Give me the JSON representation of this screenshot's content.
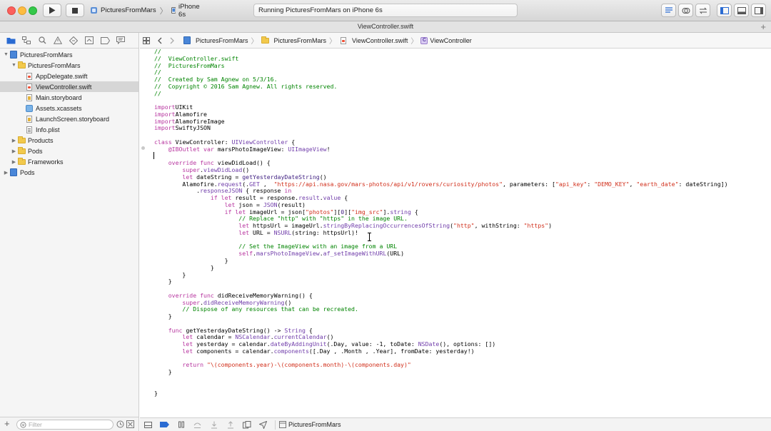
{
  "toolbar": {
    "scheme_target": "PicturesFromMars",
    "scheme_device": "iPhone 6s",
    "status_text": "Running PicturesFromMars on iPhone 6s"
  },
  "tab_title": "ViewController.swift",
  "navigator": {
    "items": [
      {
        "label": "PicturesFromMars",
        "type": "project",
        "depth": 0,
        "expanded": true
      },
      {
        "label": "PicturesFromMars",
        "type": "folder",
        "depth": 1,
        "expanded": true
      },
      {
        "label": "AppDelegate.swift",
        "type": "swift",
        "depth": 2
      },
      {
        "label": "ViewController.swift",
        "type": "swift",
        "depth": 2,
        "selected": true
      },
      {
        "label": "Main.storyboard",
        "type": "storyboard",
        "depth": 2
      },
      {
        "label": "Assets.xcassets",
        "type": "assets",
        "depth": 2
      },
      {
        "label": "LaunchScreen.storyboard",
        "type": "storyboard",
        "depth": 2
      },
      {
        "label": "Info.plist",
        "type": "plist",
        "depth": 2
      },
      {
        "label": "Products",
        "type": "folder",
        "depth": 1,
        "expanded": false
      },
      {
        "label": "Pods",
        "type": "folder",
        "depth": 1,
        "expanded": false
      },
      {
        "label": "Frameworks",
        "type": "folder",
        "depth": 1,
        "expanded": false
      },
      {
        "label": "Pods",
        "type": "project",
        "depth": 0,
        "expanded": false
      }
    ],
    "filter_placeholder": "Filter"
  },
  "jumpbar": {
    "crumbs": [
      "PicturesFromMars",
      "PicturesFromMars",
      "ViewController.swift",
      "ViewController"
    ]
  },
  "code_lines": [
    [
      [
        "cm",
        "//"
      ]
    ],
    [
      [
        "cm",
        "//  ViewController.swift"
      ]
    ],
    [
      [
        "cm",
        "//  PicturesFromMars"
      ]
    ],
    [
      [
        "cm",
        "//"
      ]
    ],
    [
      [
        "cm",
        "//  Created by Sam Agnew on 5/3/16."
      ]
    ],
    [
      [
        "cm",
        "//  Copyright © 2016 Sam Agnew. All rights reserved."
      ]
    ],
    [
      [
        "cm",
        "//"
      ]
    ],
    [],
    [
      [
        "kw",
        "import"
      ],
      [
        "",
        "UIKit"
      ]
    ],
    [
      [
        "kw",
        "import"
      ],
      [
        "",
        "Alamofire"
      ]
    ],
    [
      [
        "kw",
        "import"
      ],
      [
        "",
        "AlamofireImage"
      ]
    ],
    [
      [
        "kw",
        "import"
      ],
      [
        "",
        "SwiftyJSON"
      ]
    ],
    [],
    [
      [
        "kw",
        "class"
      ],
      [
        "",
        " ViewController: "
      ],
      [
        "ty",
        "UIViewController"
      ],
      [
        "",
        " {"
      ]
    ],
    [
      [
        "",
        " "
      ],
      [
        "kw",
        "   @IBOutlet var"
      ],
      [
        "",
        " marsPhotoImageView: "
      ],
      [
        "ty",
        "UIImageView"
      ],
      [
        "",
        "!"
      ]
    ],
    [],
    [
      [
        "kw",
        "    override func"
      ],
      [
        "",
        " viewDidLoad() {"
      ]
    ],
    [
      [
        "kw",
        "        super"
      ],
      [
        "",
        "."
      ],
      [
        "ty",
        "viewDidLoad"
      ],
      [
        "",
        "()"
      ]
    ],
    [
      [
        "kw",
        "        let"
      ],
      [
        "",
        " dateString = "
      ],
      [
        "fn",
        "getYesterdayDateString"
      ],
      [
        "",
        "()"
      ]
    ],
    [
      [
        "",
        "        Alamofire."
      ],
      [
        "ty",
        "request"
      ],
      [
        "",
        "(."
      ],
      [
        "ty",
        "GET"
      ],
      [
        "",
        " ,  "
      ],
      [
        "st",
        "\"https://api.nasa.gov/mars-photos/api/v1/rovers/curiosity/photos\""
      ],
      [
        "",
        ", parameters: ["
      ],
      [
        "st",
        "\"api_key\""
      ],
      [
        "",
        ": "
      ],
      [
        "st",
        "\"DEMO_KEY\""
      ],
      [
        "",
        ", "
      ],
      [
        "st",
        "\"earth_date\""
      ],
      [
        "",
        ": dateString])"
      ]
    ],
    [
      [
        "",
        "            ."
      ],
      [
        "ty",
        "responseJSON"
      ],
      [
        "",
        " { response "
      ],
      [
        "kw",
        "in"
      ]
    ],
    [
      [
        "kw",
        "                if let"
      ],
      [
        "",
        " result = response."
      ],
      [
        "ty",
        "result"
      ],
      [
        "",
        "."
      ],
      [
        "ty",
        "value"
      ],
      [
        "",
        " {"
      ]
    ],
    [
      [
        "kw",
        "                    let"
      ],
      [
        "",
        " json = "
      ],
      [
        "ty",
        "JSON"
      ],
      [
        "",
        "(result)"
      ]
    ],
    [
      [
        "kw",
        "                    if let"
      ],
      [
        "",
        " imageUrl = json["
      ],
      [
        "st",
        "\"photos\""
      ],
      [
        "",
        "]["
      ],
      [
        "fn",
        "0"
      ],
      [
        "",
        "]["
      ],
      [
        "st",
        "\"img_src\""
      ],
      [
        "",
        "]."
      ],
      [
        "ty",
        "string"
      ],
      [
        "",
        " {"
      ]
    ],
    [
      [
        "cm",
        "                        // Replace \"http\" with \"https\" in the image URL."
      ]
    ],
    [
      [
        "kw",
        "                        let"
      ],
      [
        "",
        " httpsUrl = imageUrl."
      ],
      [
        "ty",
        "stringByReplacingOccurrencesOfString"
      ],
      [
        "",
        "("
      ],
      [
        "st",
        "\"http\""
      ],
      [
        "",
        ", withString: "
      ],
      [
        "st",
        "\"https\""
      ],
      [
        "",
        ")"
      ]
    ],
    [
      [
        "kw",
        "                        let"
      ],
      [
        "",
        " URL = "
      ],
      [
        "ty",
        "NSURL"
      ],
      [
        "",
        "(string: httpsUrl)!"
      ]
    ],
    [],
    [
      [
        "cm",
        "                        // Set the ImageView with an image from a URL"
      ]
    ],
    [
      [
        "kw",
        "                        self"
      ],
      [
        "",
        "."
      ],
      [
        "ty",
        "marsPhotoImageView"
      ],
      [
        "",
        "."
      ],
      [
        "ty",
        "af_setImageWithURL"
      ],
      [
        "",
        "(URL)"
      ]
    ],
    [
      [
        "",
        "                    }"
      ]
    ],
    [
      [
        "",
        "                }"
      ]
    ],
    [
      [
        "",
        "        }"
      ]
    ],
    [
      [
        "",
        "    }"
      ]
    ],
    [],
    [
      [
        "kw",
        "    override func"
      ],
      [
        "",
        " didReceiveMemoryWarning() {"
      ]
    ],
    [
      [
        "kw",
        "        super"
      ],
      [
        "",
        "."
      ],
      [
        "ty",
        "didReceiveMemoryWarning"
      ],
      [
        "",
        "()"
      ]
    ],
    [
      [
        "cm",
        "        // Dispose of any resources that can be recreated."
      ]
    ],
    [
      [
        "",
        "    }"
      ]
    ],
    [],
    [
      [
        "kw",
        "    func"
      ],
      [
        "",
        " getYesterdayDateString() -> "
      ],
      [
        "ty",
        "String"
      ],
      [
        "",
        " {"
      ]
    ],
    [
      [
        "kw",
        "        let"
      ],
      [
        "",
        " calendar = "
      ],
      [
        "ty",
        "NSCalendar"
      ],
      [
        "",
        "."
      ],
      [
        "ty",
        "currentCalendar"
      ],
      [
        "",
        "()"
      ]
    ],
    [
      [
        "kw",
        "        let"
      ],
      [
        "",
        " yesterday = calendar."
      ],
      [
        "ty",
        "dateByAddingUnit"
      ],
      [
        "",
        "(.Day, value: -1, toDate: "
      ],
      [
        "ty",
        "NSDate"
      ],
      [
        "",
        "(), options: [])"
      ]
    ],
    [
      [
        "kw",
        "        let"
      ],
      [
        "",
        " components = calendar."
      ],
      [
        "ty",
        "components"
      ],
      [
        "",
        "([.Day , .Month , .Year], fromDate: yesterday!)"
      ]
    ],
    [],
    [
      [
        "kw",
        "        return"
      ],
      [
        "",
        ""
      ],
      [
        "st",
        " \"\\(components.year)-\\(components.month)-\\(components.day)\""
      ]
    ],
    [
      [
        "",
        "    }"
      ]
    ],
    [],
    [],
    [
      [
        "",
        "}"
      ]
    ]
  ],
  "debugbar": {
    "target_label": "PicturesFromMars"
  }
}
